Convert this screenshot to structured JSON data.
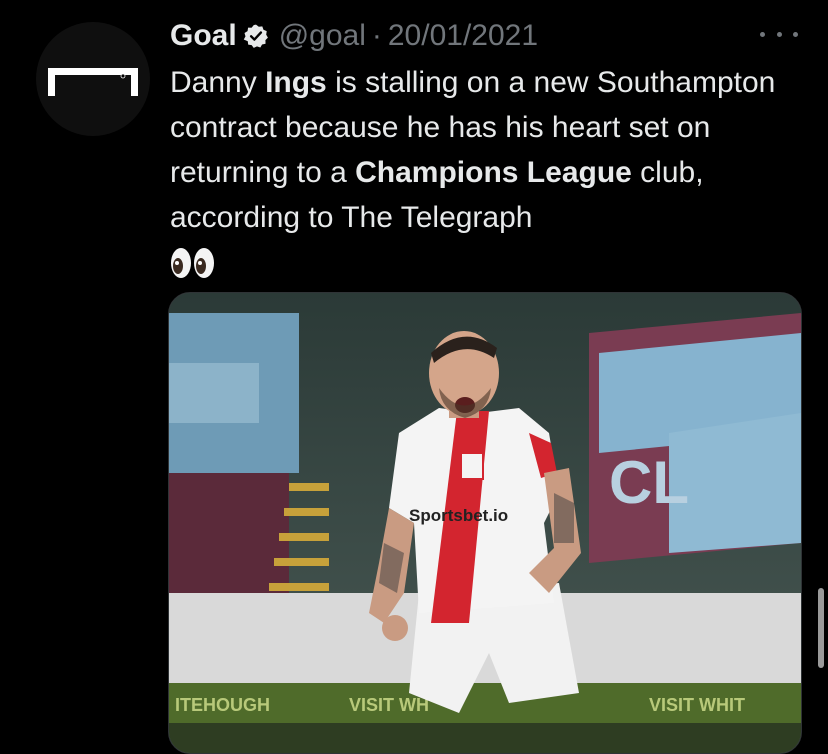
{
  "tweet": {
    "author": {
      "display_name": "Goal",
      "handle": "@goal",
      "verified": true,
      "avatar_icon": "goal-logo-icon"
    },
    "separator": "·",
    "date": "20/01/2021",
    "more_icon": "more-icon",
    "text": {
      "segments": [
        {
          "text": "Danny ",
          "bold": false
        },
        {
          "text": "Ings",
          "bold": true
        },
        {
          "text": " is stalling on a new Southampton contract because he has his heart set on returning to a ",
          "bold": false
        },
        {
          "text": "Champions League",
          "bold": true
        },
        {
          "text": " club, according to The Telegraph",
          "bold": false
        }
      ],
      "emoji": "eyes-emoji"
    },
    "media": {
      "shirt_sponsor": "Sportsbet.io",
      "stadium_board_left": "ITEHOUGH",
      "stadium_board_mid": "VISIT WH",
      "stadium_board_right": "VISIT WHIT",
      "stand_letters": "CL"
    }
  },
  "colors": {
    "background": "#000000",
    "text": "#e7e9ea",
    "secondary": "#71767b",
    "border": "#2f3336"
  }
}
